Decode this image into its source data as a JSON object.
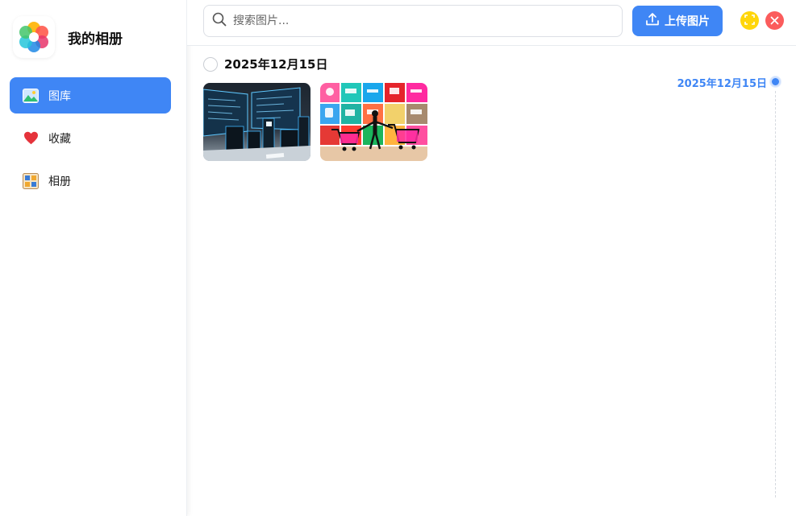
{
  "app": {
    "title": "我的相册"
  },
  "sidebar": {
    "items": [
      {
        "label": "图库",
        "icon": "gallery-icon",
        "active": true
      },
      {
        "label": "收藏",
        "icon": "heart-icon",
        "active": false
      },
      {
        "label": "相册",
        "icon": "album-icon",
        "active": false
      }
    ]
  },
  "search": {
    "placeholder": "搜索图片...",
    "value": ""
  },
  "toolbar": {
    "upload_label": "上传图片"
  },
  "window": {
    "maximize_icon": "maximize-icon",
    "close_icon": "close-icon"
  },
  "groups": [
    {
      "date": "2025年12月15日",
      "photos": [
        {
          "icon": "server-room-thumbnail"
        },
        {
          "icon": "shopping-apps-thumbnail"
        }
      ]
    }
  ],
  "timeline": {
    "entries": [
      "2025年12月15日"
    ]
  },
  "colors": {
    "accent": "#3f86f5",
    "maximize": "#ffd60a",
    "close": "#fb5c5c"
  }
}
